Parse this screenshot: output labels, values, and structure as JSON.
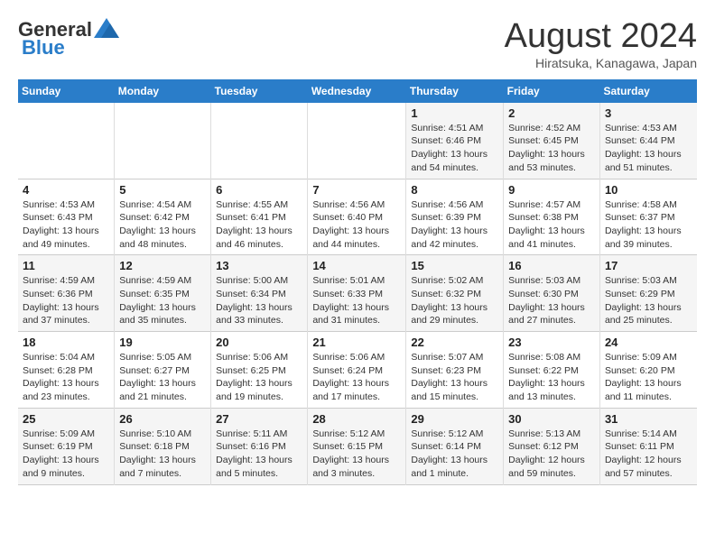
{
  "header": {
    "logo_general": "General",
    "logo_blue": "Blue",
    "month_title": "August 2024",
    "location": "Hiratsuka, Kanagawa, Japan"
  },
  "days_of_week": [
    "Sunday",
    "Monday",
    "Tuesday",
    "Wednesday",
    "Thursday",
    "Friday",
    "Saturday"
  ],
  "weeks": [
    [
      {
        "day": "",
        "info": ""
      },
      {
        "day": "",
        "info": ""
      },
      {
        "day": "",
        "info": ""
      },
      {
        "day": "",
        "info": ""
      },
      {
        "day": "1",
        "info": "Sunrise: 4:51 AM\nSunset: 6:46 PM\nDaylight: 13 hours\nand 54 minutes."
      },
      {
        "day": "2",
        "info": "Sunrise: 4:52 AM\nSunset: 6:45 PM\nDaylight: 13 hours\nand 53 minutes."
      },
      {
        "day": "3",
        "info": "Sunrise: 4:53 AM\nSunset: 6:44 PM\nDaylight: 13 hours\nand 51 minutes."
      }
    ],
    [
      {
        "day": "4",
        "info": "Sunrise: 4:53 AM\nSunset: 6:43 PM\nDaylight: 13 hours\nand 49 minutes."
      },
      {
        "day": "5",
        "info": "Sunrise: 4:54 AM\nSunset: 6:42 PM\nDaylight: 13 hours\nand 48 minutes."
      },
      {
        "day": "6",
        "info": "Sunrise: 4:55 AM\nSunset: 6:41 PM\nDaylight: 13 hours\nand 46 minutes."
      },
      {
        "day": "7",
        "info": "Sunrise: 4:56 AM\nSunset: 6:40 PM\nDaylight: 13 hours\nand 44 minutes."
      },
      {
        "day": "8",
        "info": "Sunrise: 4:56 AM\nSunset: 6:39 PM\nDaylight: 13 hours\nand 42 minutes."
      },
      {
        "day": "9",
        "info": "Sunrise: 4:57 AM\nSunset: 6:38 PM\nDaylight: 13 hours\nand 41 minutes."
      },
      {
        "day": "10",
        "info": "Sunrise: 4:58 AM\nSunset: 6:37 PM\nDaylight: 13 hours\nand 39 minutes."
      }
    ],
    [
      {
        "day": "11",
        "info": "Sunrise: 4:59 AM\nSunset: 6:36 PM\nDaylight: 13 hours\nand 37 minutes."
      },
      {
        "day": "12",
        "info": "Sunrise: 4:59 AM\nSunset: 6:35 PM\nDaylight: 13 hours\nand 35 minutes."
      },
      {
        "day": "13",
        "info": "Sunrise: 5:00 AM\nSunset: 6:34 PM\nDaylight: 13 hours\nand 33 minutes."
      },
      {
        "day": "14",
        "info": "Sunrise: 5:01 AM\nSunset: 6:33 PM\nDaylight: 13 hours\nand 31 minutes."
      },
      {
        "day": "15",
        "info": "Sunrise: 5:02 AM\nSunset: 6:32 PM\nDaylight: 13 hours\nand 29 minutes."
      },
      {
        "day": "16",
        "info": "Sunrise: 5:03 AM\nSunset: 6:30 PM\nDaylight: 13 hours\nand 27 minutes."
      },
      {
        "day": "17",
        "info": "Sunrise: 5:03 AM\nSunset: 6:29 PM\nDaylight: 13 hours\nand 25 minutes."
      }
    ],
    [
      {
        "day": "18",
        "info": "Sunrise: 5:04 AM\nSunset: 6:28 PM\nDaylight: 13 hours\nand 23 minutes."
      },
      {
        "day": "19",
        "info": "Sunrise: 5:05 AM\nSunset: 6:27 PM\nDaylight: 13 hours\nand 21 minutes."
      },
      {
        "day": "20",
        "info": "Sunrise: 5:06 AM\nSunset: 6:25 PM\nDaylight: 13 hours\nand 19 minutes."
      },
      {
        "day": "21",
        "info": "Sunrise: 5:06 AM\nSunset: 6:24 PM\nDaylight: 13 hours\nand 17 minutes."
      },
      {
        "day": "22",
        "info": "Sunrise: 5:07 AM\nSunset: 6:23 PM\nDaylight: 13 hours\nand 15 minutes."
      },
      {
        "day": "23",
        "info": "Sunrise: 5:08 AM\nSunset: 6:22 PM\nDaylight: 13 hours\nand 13 minutes."
      },
      {
        "day": "24",
        "info": "Sunrise: 5:09 AM\nSunset: 6:20 PM\nDaylight: 13 hours\nand 11 minutes."
      }
    ],
    [
      {
        "day": "25",
        "info": "Sunrise: 5:09 AM\nSunset: 6:19 PM\nDaylight: 13 hours\nand 9 minutes."
      },
      {
        "day": "26",
        "info": "Sunrise: 5:10 AM\nSunset: 6:18 PM\nDaylight: 13 hours\nand 7 minutes."
      },
      {
        "day": "27",
        "info": "Sunrise: 5:11 AM\nSunset: 6:16 PM\nDaylight: 13 hours\nand 5 minutes."
      },
      {
        "day": "28",
        "info": "Sunrise: 5:12 AM\nSunset: 6:15 PM\nDaylight: 13 hours\nand 3 minutes."
      },
      {
        "day": "29",
        "info": "Sunrise: 5:12 AM\nSunset: 6:14 PM\nDaylight: 13 hours\nand 1 minute."
      },
      {
        "day": "30",
        "info": "Sunrise: 5:13 AM\nSunset: 6:12 PM\nDaylight: 12 hours\nand 59 minutes."
      },
      {
        "day": "31",
        "info": "Sunrise: 5:14 AM\nSunset: 6:11 PM\nDaylight: 12 hours\nand 57 minutes."
      }
    ]
  ]
}
